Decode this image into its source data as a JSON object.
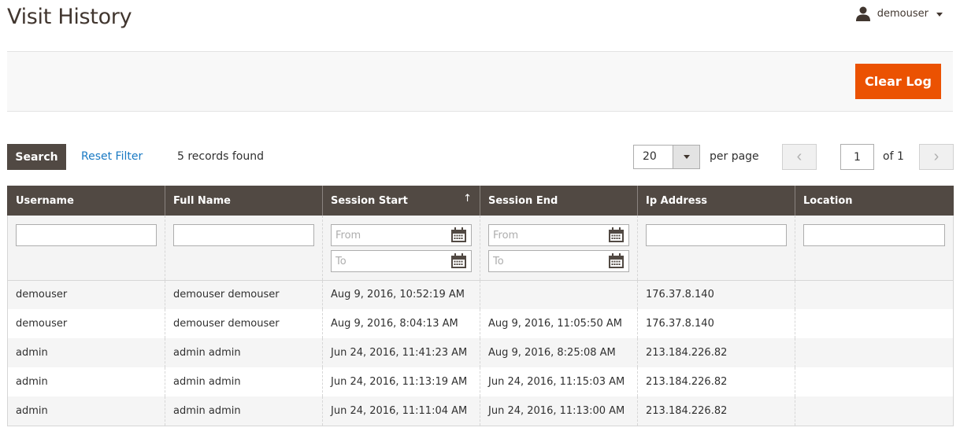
{
  "header": {
    "title": "Visit History",
    "user": {
      "name": "demouser",
      "icon": "user-icon"
    }
  },
  "actions": {
    "clear_log_label": "Clear Log",
    "clear_log_color": "#eb5202"
  },
  "toolbar": {
    "search_label": "Search",
    "reset_filter_label": "Reset Filter",
    "records_found": "5 records found",
    "per_page_value": "20",
    "per_page_label": "per page",
    "page_current": "1",
    "page_total": "of 1",
    "prev_icon": "‹",
    "next_icon": "›"
  },
  "grid": {
    "columns": [
      {
        "label": "Username"
      },
      {
        "label": "Full Name"
      },
      {
        "label": "Session Start",
        "sort": "↑"
      },
      {
        "label": "Session End"
      },
      {
        "label": "Ip Address"
      },
      {
        "label": "Location"
      }
    ],
    "filters": {
      "username": "",
      "full_name": "",
      "session_start_from_placeholder": "From",
      "session_start_to_placeholder": "To",
      "session_end_from_placeholder": "From",
      "session_end_to_placeholder": "To",
      "ip_address": "",
      "location": ""
    },
    "rows": [
      {
        "username": "demouser",
        "full_name": "demouser demouser",
        "session_start": "Aug 9, 2016, 10:52:19 AM",
        "session_end": "",
        "ip": "176.37.8.140",
        "location": ""
      },
      {
        "username": "demouser",
        "full_name": "demouser demouser",
        "session_start": "Aug 9, 2016, 8:04:13 AM",
        "session_end": "Aug 9, 2016, 11:05:50 AM",
        "ip": "176.37.8.140",
        "location": ""
      },
      {
        "username": "admin",
        "full_name": "admin admin",
        "session_start": "Jun 24, 2016, 11:41:23 AM",
        "session_end": "Aug 9, 2016, 8:25:08 AM",
        "ip": "213.184.226.82",
        "location": ""
      },
      {
        "username": "admin",
        "full_name": "admin admin",
        "session_start": "Jun 24, 2016, 11:13:19 AM",
        "session_end": "Jun 24, 2016, 11:15:03 AM",
        "ip": "213.184.226.82",
        "location": ""
      },
      {
        "username": "admin",
        "full_name": "admin admin",
        "session_start": "Jun 24, 2016, 11:11:04 AM",
        "session_end": "Jun 24, 2016, 11:13:00 AM",
        "ip": "213.184.226.82",
        "location": ""
      }
    ]
  }
}
